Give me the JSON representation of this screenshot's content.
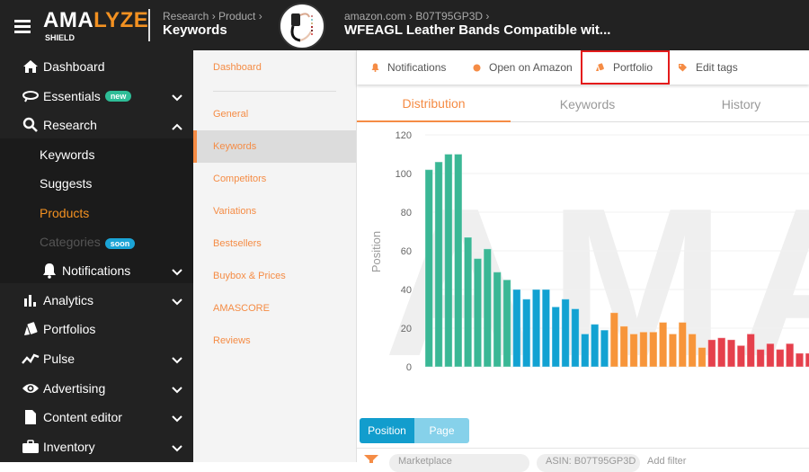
{
  "header": {
    "logo_part1": "AMA",
    "logo_part2": "LYZE",
    "logo_sub": "SHIELD",
    "breadcrumb": "Research › Product ›",
    "title": "Keywords",
    "product_breadcrumb": "amazon.com › B07T95GP3D ›",
    "product_title": "WFEAGL Leather Bands Compatible wit..."
  },
  "sidebar": {
    "items": [
      {
        "label": "Dashboard",
        "icon": "home-icon"
      },
      {
        "label": "Essentials",
        "icon": "essentials-icon",
        "badge": "new"
      },
      {
        "label": "Research",
        "icon": "search-icon"
      },
      {
        "label": "Analytics",
        "icon": "bar-chart-icon"
      },
      {
        "label": "Portfolios",
        "icon": "portfolio-icon"
      },
      {
        "label": "Pulse",
        "icon": "pulse-icon"
      },
      {
        "label": "Advertising",
        "icon": "eye-icon"
      },
      {
        "label": "Content editor",
        "icon": "document-icon"
      },
      {
        "label": "Inventory",
        "icon": "briefcase-icon"
      }
    ],
    "research_sub": [
      {
        "label": "Keywords"
      },
      {
        "label": "Suggests"
      },
      {
        "label": "Products",
        "active": true
      },
      {
        "label": "Categories",
        "badge": "soon",
        "disabled": true
      },
      {
        "label": "Notifications",
        "icon": "bell-icon"
      }
    ]
  },
  "subnav": {
    "items": [
      "Dashboard",
      "General",
      "Keywords",
      "Competitors",
      "Variations",
      "Bestsellers",
      "Buybox & Prices",
      "AMASCORE",
      "Reviews"
    ],
    "active": "Keywords"
  },
  "actions": {
    "notifications": "Notifications",
    "open_amazon": "Open on Amazon",
    "portfolio": "Portfolio",
    "edit_tags": "Edit tags"
  },
  "tabs": [
    "Distribution",
    "Keywords",
    "History"
  ],
  "active_tab": "Distribution",
  "toggle": {
    "position": "Position",
    "page": "Page",
    "selected": "Position"
  },
  "filters": {
    "marketplace": "Marketplace",
    "asin": "ASIN: B07T95GP3D",
    "add": "Add filter"
  },
  "watermark": "AMA",
  "colors": {
    "accent": "#f58c45",
    "green": "#3ab795",
    "blue": "#12a2d2",
    "orange": "#f7953a",
    "red": "#e5404c",
    "new_badge": "#2ebd97",
    "soon_badge": "#1ba4d6"
  },
  "chart_data": {
    "type": "bar",
    "title": "",
    "xlabel": "",
    "ylabel": "Position",
    "ylim": [
      0,
      120
    ],
    "yticks": [
      0,
      20,
      40,
      60,
      80,
      100,
      120
    ],
    "grid": true,
    "series": [
      {
        "name": "green",
        "color": "#3ab795",
        "values": [
          102,
          106,
          110,
          110,
          67,
          56,
          61,
          49,
          45
        ]
      },
      {
        "name": "blue",
        "color": "#12a2d2",
        "values": [
          40,
          35,
          40,
          40,
          31,
          35,
          30,
          17,
          22,
          19
        ]
      },
      {
        "name": "orange",
        "color": "#f7953a",
        "values": [
          28,
          21,
          17,
          18,
          18,
          23,
          17,
          23,
          17,
          10
        ]
      },
      {
        "name": "red",
        "color": "#e5404c",
        "values": [
          14,
          15,
          14,
          11,
          17,
          9,
          12,
          9,
          12,
          7,
          7
        ]
      }
    ]
  }
}
